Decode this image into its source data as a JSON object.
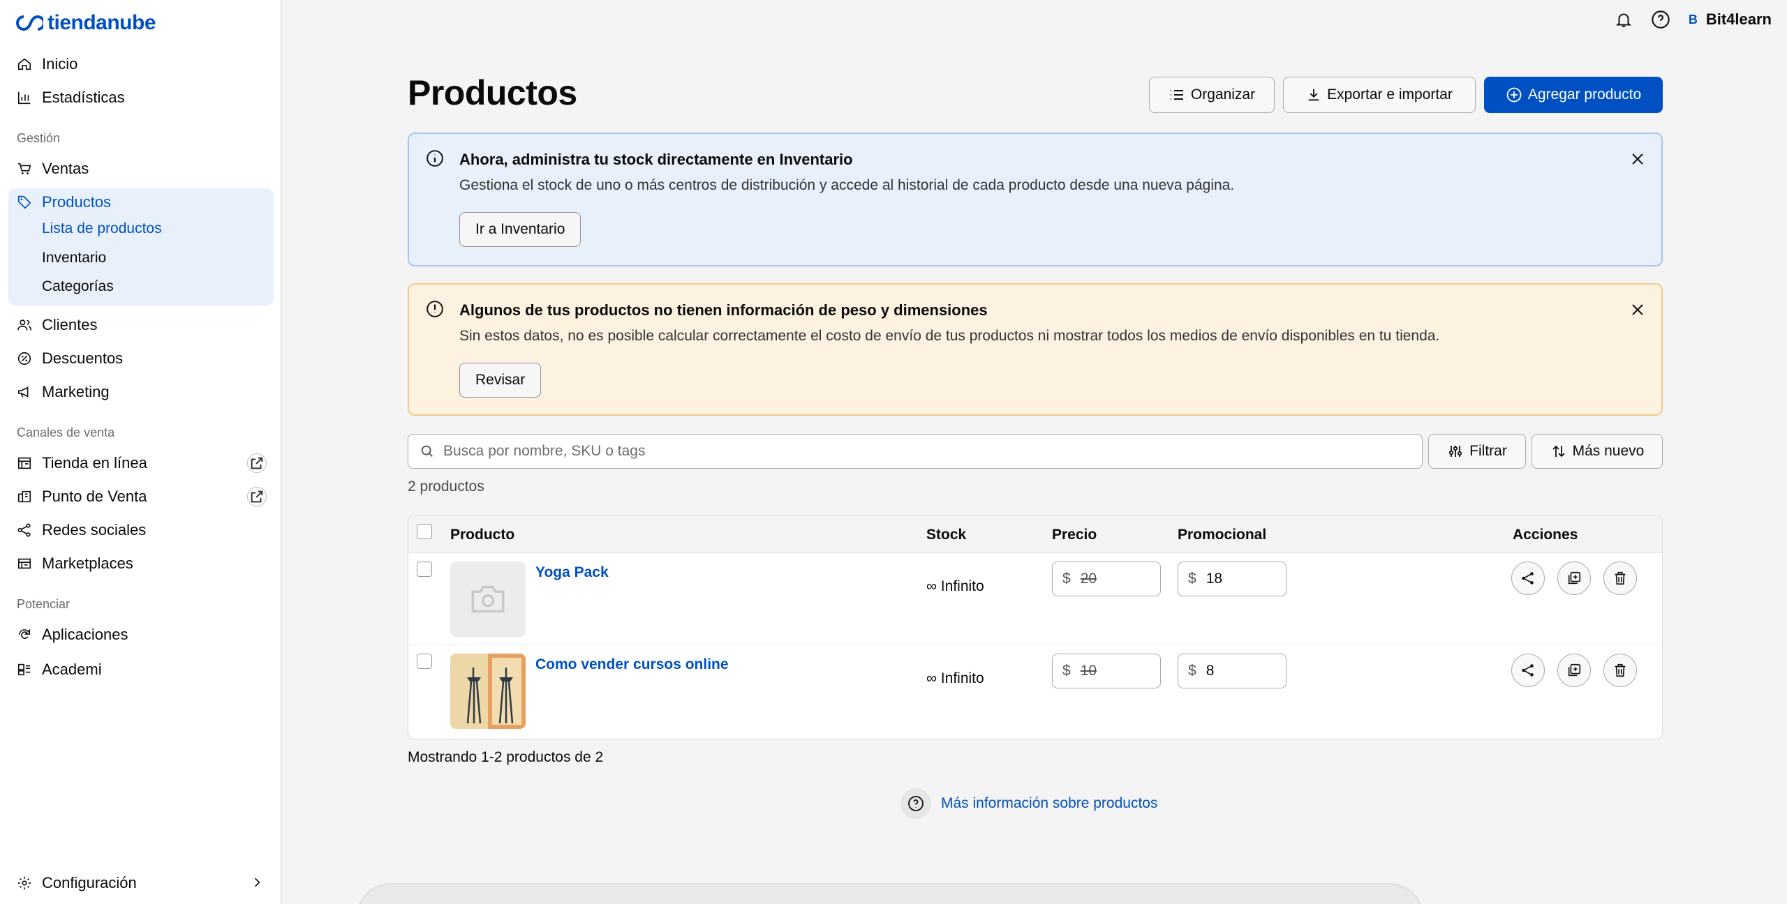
{
  "brand": {
    "name": "tiendanube",
    "color": "#0050c3"
  },
  "sidebar": {
    "top_items": [
      {
        "label": "Inicio",
        "icon": "home-icon"
      },
      {
        "label": "Estadísticas",
        "icon": "chart-icon"
      }
    ],
    "sections": [
      {
        "title": "Gestión"
      },
      {
        "title": "Canales de venta"
      },
      {
        "title": "Potenciar"
      }
    ],
    "gestion_items": [
      {
        "label": "Ventas",
        "icon": "cart-icon"
      },
      {
        "label": "Productos",
        "icon": "tag-icon"
      },
      {
        "label": "Clientes",
        "icon": "users-icon"
      },
      {
        "label": "Descuentos",
        "icon": "discount-icon"
      },
      {
        "label": "Marketing",
        "icon": "megaphone-icon"
      }
    ],
    "productos_sub": [
      {
        "label": "Lista de productos"
      },
      {
        "label": "Inventario"
      },
      {
        "label": "Categorías"
      }
    ],
    "canales_items": [
      {
        "label": "Tienda en línea",
        "icon": "store-icon"
      },
      {
        "label": "Punto de Venta",
        "icon": "pos-icon"
      },
      {
        "label": "Redes sociales",
        "icon": "share-icon"
      },
      {
        "label": "Marketplaces",
        "icon": "marketplace-icon"
      }
    ],
    "potenciar_items": [
      {
        "label": "Aplicaciones",
        "icon": "apps-icon"
      },
      {
        "label": "Academi",
        "icon": "academy-icon"
      }
    ],
    "config_label": "Configuración"
  },
  "topbar": {
    "avatar_letter": "B",
    "user_name": "Bit4learn"
  },
  "header": {
    "title": "Productos",
    "organize_label": "Organizar",
    "export_label": "Exportar e importar",
    "add_label": "Agregar producto"
  },
  "banners": {
    "info": {
      "title": "Ahora, administra tu stock directamente en Inventario",
      "text": "Gestiona el stock de uno o más centros de distribución y accede al historial de cada producto desde una nueva página.",
      "button": "Ir a Inventario"
    },
    "warning": {
      "title": "Algunos de tus productos no tienen información de peso y dimensiones",
      "text": "Sin estos datos, no es posible calcular correctamente el costo de envío de tus productos ni mostrar todos los medios de envío disponibles en tu tienda.",
      "button": "Revisar"
    }
  },
  "search": {
    "placeholder": "Busca por nombre, SKU o tags",
    "filter_label": "Filtrar",
    "sort_label": "Más nuevo"
  },
  "product_count": "2 productos",
  "table": {
    "columns": {
      "product": "Producto",
      "stock": "Stock",
      "price": "Precio",
      "promo": "Promocional",
      "actions": "Acciones"
    },
    "rows": [
      {
        "name": "Yoga Pack",
        "stock": "∞ Infinito",
        "currency": "$",
        "price": "20",
        "promo": "18"
      },
      {
        "name": "Como vender cursos online",
        "stock": "∞ Infinito",
        "currency": "$",
        "price": "10",
        "promo": "8"
      }
    ]
  },
  "showing": "Mostrando 1-2 productos de 2",
  "more_info": "Más información sobre productos"
}
